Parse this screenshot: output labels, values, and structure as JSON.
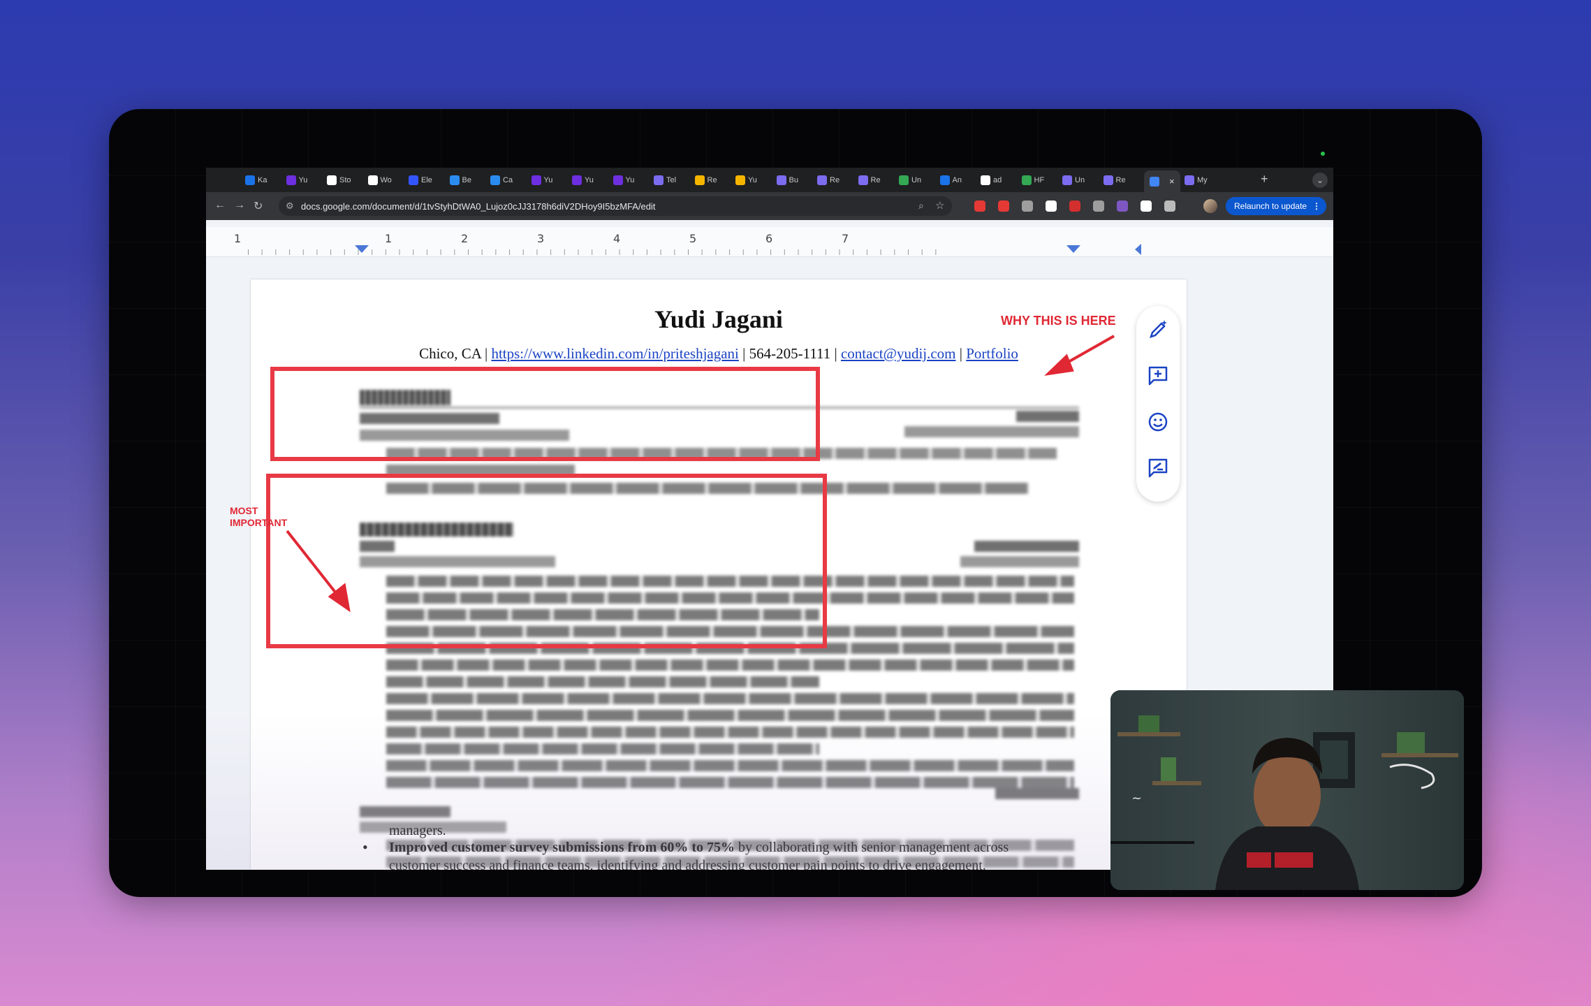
{
  "browser": {
    "tabs": [
      {
        "label": "Ka",
        "color": "#1a73e8"
      },
      {
        "label": "Yu",
        "color": "#6d2fe0"
      },
      {
        "label": "Sto",
        "color": "#ffffff"
      },
      {
        "label": "Wo",
        "color": "#ffffff"
      },
      {
        "label": "Ele",
        "color": "#3355ff"
      },
      {
        "label": "Be",
        "color": "#2b8cf0"
      },
      {
        "label": "Ca",
        "color": "#2b8cf0"
      },
      {
        "label": "Yu",
        "color": "#6d2fe0"
      },
      {
        "label": "Yu",
        "color": "#6d2fe0"
      },
      {
        "label": "Yu",
        "color": "#6d2fe0"
      },
      {
        "label": "Tel",
        "color": "#7b6cf0"
      },
      {
        "label": "Re",
        "color": "#f4b400"
      },
      {
        "label": "Yu",
        "color": "#f4b400"
      },
      {
        "label": "Bu",
        "color": "#7b6cf0"
      },
      {
        "label": "Re",
        "color": "#7b6cf0"
      },
      {
        "label": "Re",
        "color": "#7b6cf0"
      },
      {
        "label": "Un",
        "color": "#34a853"
      },
      {
        "label": "An",
        "color": "#1a73e8"
      },
      {
        "label": "ad",
        "color": "#ffffff"
      },
      {
        "label": "HF",
        "color": "#34a853"
      },
      {
        "label": "Un",
        "color": "#7b6cf0"
      },
      {
        "label": "Re",
        "color": "#7b6cf0"
      },
      {
        "label": "",
        "color": "#4285f4",
        "active": true
      },
      {
        "label": "My",
        "color": "#7b6cf0"
      }
    ],
    "new_tab": "+",
    "tab_menu": "⌄",
    "url": "docs.google.com/document/d/1tvStyhDtWA0_Lujoz0cJJ3178h6diV2DHoy9I5bzMFA/edit",
    "relaunch_label": "Relaunch to update",
    "relaunch_more": "⋮",
    "extension_colors": [
      "#e53935",
      "#e53935",
      "#9e9e9e",
      "#ffffff",
      "#d32f2f",
      "#9e9e9e",
      "#7e57c2",
      "#ffffff",
      "#bbbbbb"
    ]
  },
  "ruler": {
    "numbers": [
      "1",
      "1",
      "2",
      "3",
      "4",
      "5",
      "6",
      "7"
    ]
  },
  "resume": {
    "name": "Yudi Jagani",
    "contact_prefix": "Chico, CA | ",
    "linkedin": "https://www.linkedin.com/in/priteshjagani",
    "phone_sep": " | 564-205-1111 | ",
    "email": "contact@yudij.com",
    "sep": " | ",
    "portfolio": "Portfolio",
    "bottom_text_1": "managers.",
    "bottom_bold": "Improved customer survey submissions from 60% to 75%",
    "bottom_rest": " by collaborating with senior management across",
    "bottom_text_2": "customer success and finance teams, identifying and addressing customer pain points to drive engagement."
  },
  "annotations": {
    "why_here": "WHY THIS IS HERE",
    "most_important_1": "MOST",
    "most_important_2": "IMPORTANT",
    "color": "#e02834"
  },
  "side_panel": {
    "icons": [
      "edit-sparkle-icon",
      "add-comment-icon",
      "emoji-icon",
      "suggest-edit-icon"
    ],
    "accent": "#1a43c4"
  }
}
